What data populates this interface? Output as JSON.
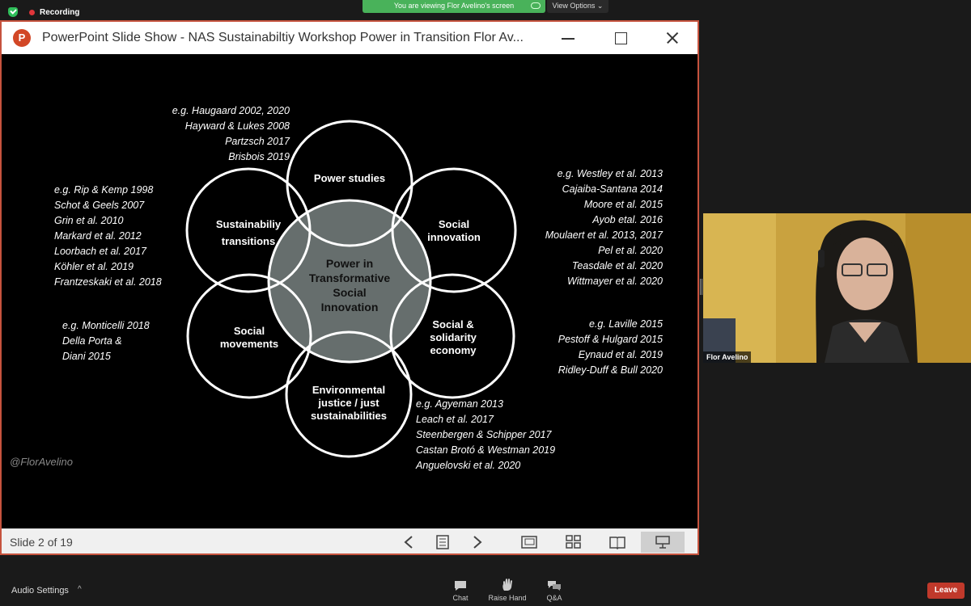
{
  "zoom": {
    "recording_label": "Recording",
    "viewing_banner": "You are viewing Flor Avelino's screen",
    "view_options_label": "View Options ⌄",
    "participant_name": "Flor Avelino",
    "bottom": {
      "audio_settings": "Audio Settings",
      "audio_chevron": "^",
      "chat": "Chat",
      "raise_hand": "Raise Hand",
      "qa": "Q&A",
      "leave": "Leave"
    },
    "colors": {
      "leave": "#c0392b",
      "banner": "#49b25a",
      "recording_dot": "#e0353a"
    }
  },
  "ppt": {
    "title": "PowerPoint Slide Show  -  NAS Sustainabiltiy Workshop Power in Transition Flor Av...",
    "logo_letter": "P",
    "slide_counter": "Slide 2 of 19",
    "border_color": "#c6533e"
  },
  "slide": {
    "watermark": "@FlorAvelino",
    "center": [
      "Power in",
      "Transformative",
      "Social",
      "Innovation"
    ],
    "circles": {
      "power_studies": [
        "Power studies"
      ],
      "sustainability_transitions": [
        "Sustainabiliy",
        "transitions"
      ],
      "social_innovation": [
        "Social",
        "innovation"
      ],
      "social_movements": [
        "Social",
        "movements"
      ],
      "social_solidarity_economy": [
        "Social &",
        "solidarity",
        "economy"
      ],
      "environmental_justice": [
        "Environmental",
        "justice / just",
        "sustainabilities"
      ]
    },
    "refs": {
      "power_studies": [
        "e.g. Haugaard 2002, 2020",
        "Hayward & Lukes 2008",
        "Partzsch 2017",
        "Brisbois 2019"
      ],
      "transitions": [
        "e.g. Rip & Kemp 1998",
        "Schot & Geels 2007",
        "Grin et al. 2010",
        "Markard et al. 2012",
        "Loorbach et al. 2017",
        "Köhler et al. 2019",
        "Frantzeskaki et al. 2018"
      ],
      "social_innovation": [
        "e.g. Westley et al. 2013",
        "Cajaiba-Santana 2014",
        "Moore et al. 2015",
        "Ayob etal. 2016",
        "Moulaert et al. 2013, 2017",
        "Pel et al. 2020",
        "Teasdale et al. 2020",
        "Wittmayer et al. 2020"
      ],
      "movements": [
        "e.g. Monticelli 2018",
        "Della Porta &",
        "Diani 2015"
      ],
      "solidarity": [
        "e.g. Laville 2015",
        "Pestoff & Hulgard 2015",
        "Eynaud et al. 2019",
        "Ridley-Duff & Bull 2020"
      ],
      "environmental": [
        "e.g. Agyeman 2013",
        "Leach et al. 2017",
        "Steenbergen & Schipper 2017",
        "Castan Brotó & Westman 2019",
        "Anguelovski et al. 2020"
      ]
    }
  }
}
